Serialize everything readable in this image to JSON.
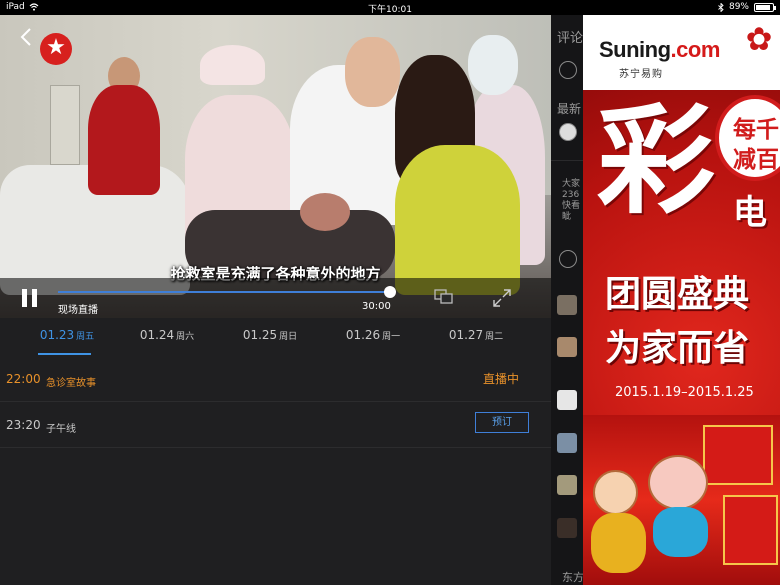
{
  "statusbar": {
    "device": "iPad",
    "wifi_icon": "wifi-icon",
    "time": "下午10:01",
    "bluetooth_icon": "bluetooth-icon",
    "battery_text": "89%",
    "battery_level": 0.89
  },
  "player": {
    "back_icon": "chevron-left-icon",
    "channel_logo_icon": "star-channel-logo",
    "subtitle": "抢救室是充满了各种意外的地方",
    "pause_icon": "pause-icon",
    "live_label": "现场直播",
    "duration": "30:00",
    "progress": 0.99,
    "airplay_icon": "screen-mirror-icon",
    "fullscreen_icon": "fullscreen-expand-icon",
    "accent": "#3f7fd8"
  },
  "schedule": {
    "tabs": [
      {
        "date": "01.23",
        "weekday": "周五",
        "active": true
      },
      {
        "date": "01.24",
        "weekday": "周六",
        "active": false
      },
      {
        "date": "01.25",
        "weekday": "周日",
        "active": false
      },
      {
        "date": "01.26",
        "weekday": "周一",
        "active": false
      },
      {
        "date": "01.27",
        "weekday": "周二",
        "active": false
      }
    ],
    "programs": [
      {
        "time": "22:00",
        "name": "急诊室故事",
        "status": "直播中"
      },
      {
        "time": "23:20",
        "name": "子午线",
        "button": "预订"
      }
    ],
    "live_color": "#e8912a"
  },
  "comments": {
    "header": "评论",
    "latest_label": "最新",
    "text_1": "大家\n236\n快看\n眦",
    "text_2": "东方"
  },
  "ad": {
    "brand": "Suning",
    "brand_suffix": ".com",
    "brand_cn": "苏宁易购",
    "big_char": "彩",
    "badge_line1": "每千",
    "badge_line2": "减百",
    "side_char": "电",
    "line1": "团圆盛典",
    "line2": "为家而省",
    "date_range": "2015.1.19–2015.1.25"
  }
}
